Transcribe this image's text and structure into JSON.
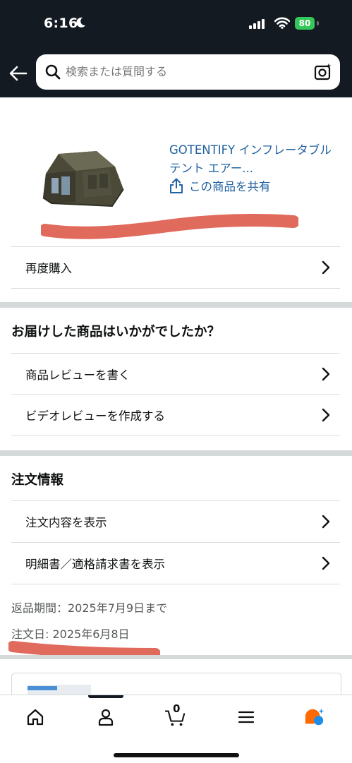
{
  "status_bar": {
    "time": "6:16",
    "battery": "80"
  },
  "search": {
    "placeholder": "検索または質問する"
  },
  "product": {
    "title": "GOTENTIFY インフレータブルテント エアー...",
    "share_label": "この商品を共有"
  },
  "actions": {
    "buy_again": "再度購入"
  },
  "review_section": {
    "title": "お届けした商品はいかがでしたか？",
    "write_review": "商品レビューを書く",
    "video_review": "ビデオレビューを作成する"
  },
  "order_section": {
    "title": "注文情報",
    "view_order": "注文内容を表示",
    "view_invoice": "明細書／適格請求書を表示",
    "return_period": "返品期間：2025年7月9日まで",
    "order_date": "注文日: 2025年6月8日"
  },
  "tab_bar": {
    "items": [
      "home-icon",
      "account-icon",
      "cart-icon",
      "menu-icon",
      "rufus-icon"
    ],
    "cart_count": "0"
  },
  "colors": {
    "header_bg": "#131a22",
    "link": "#2162a1",
    "battery": "#34c759",
    "redaction": "#e06a5c",
    "rufus_orange": "#ff6a00",
    "rufus_blue": "#1f8ee8"
  }
}
